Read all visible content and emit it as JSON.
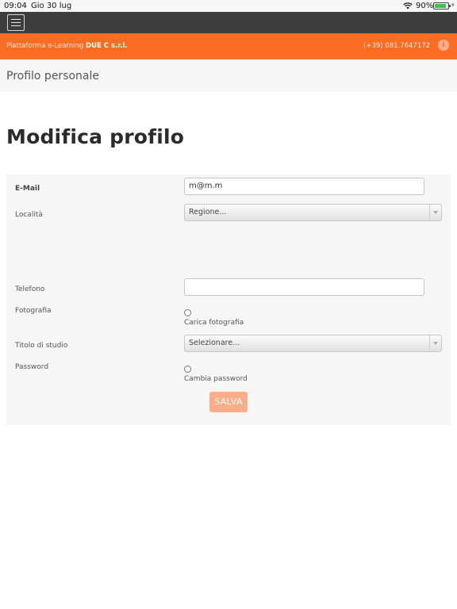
{
  "status_bar": {
    "time": "09:04",
    "date": "Gio 30 lug",
    "battery": "90%",
    "battery_level": 0.9
  },
  "banner": {
    "platform_prefix": "Piattaforma e-Learning ",
    "company": "DUE C s.r.l.",
    "phone": "(+39) 081.7647172",
    "info_icon": "i"
  },
  "page_header": {
    "title": "Profilo personale"
  },
  "main": {
    "title": "Modifica profilo"
  },
  "form": {
    "email_label": "E-Mail",
    "email_value": "m@m.m",
    "localita_label": "Località",
    "region_select": "Regione...",
    "telefono_label": "Telefono",
    "telefono_value": "",
    "fotografia_label": "Fotografia",
    "carica_foto_label": "Carica fotografia",
    "titolo_label": "Titolo di studio",
    "titolo_select": "Selezionare...",
    "password_label": "Password",
    "cambia_password_label": "Cambia password",
    "save_label": "SALVA"
  },
  "colors": {
    "accent": "#fc6c22",
    "topbar": "#3d3d3d",
    "save_button": "#f9ad88"
  }
}
